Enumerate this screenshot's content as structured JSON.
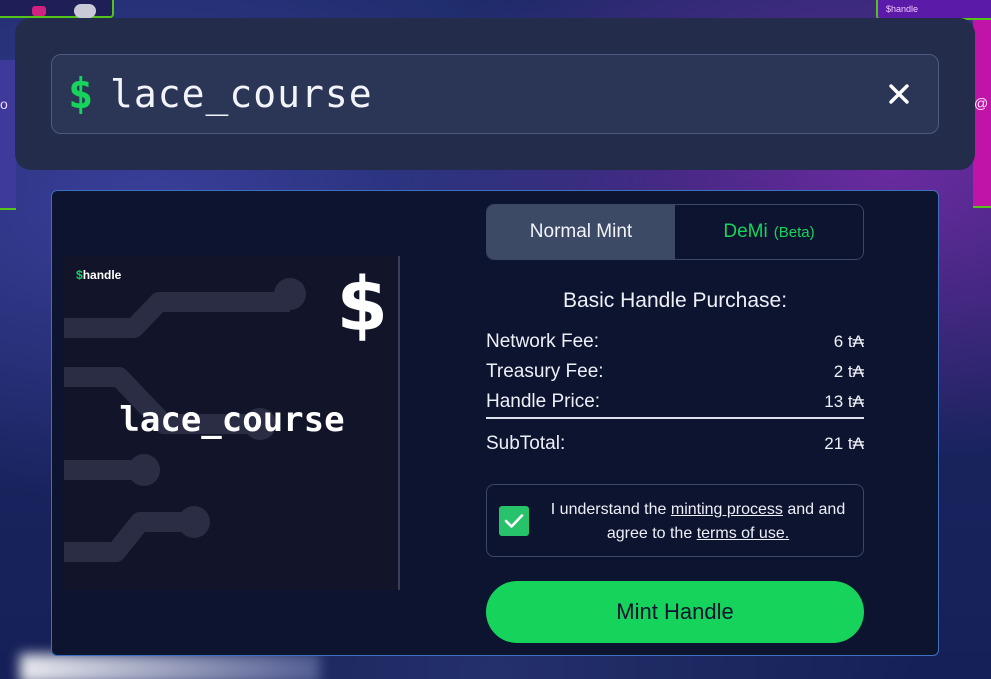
{
  "background": {
    "right_card_label": "$handle",
    "left_edge_glyph": "o",
    "right_edge_glyph": "@"
  },
  "search": {
    "prefix_icon": "dollar-icon",
    "value": "lace_course",
    "clear_icon": "close-icon"
  },
  "card": {
    "brand_prefix": "$",
    "brand_name": "handle",
    "symbol": "$",
    "handle": "lace_course"
  },
  "tabs": [
    {
      "label": "Normal Mint",
      "active": true
    },
    {
      "label": "DeMi",
      "suffix": "(Beta)",
      "active": false
    }
  ],
  "purchase": {
    "title": "Basic Handle Purchase:",
    "fees": [
      {
        "label": "Network Fee:",
        "value": "6 t₳"
      },
      {
        "label": "Treasury Fee:",
        "value": "2 t₳"
      },
      {
        "label": "Handle Price:",
        "value": "13 t₳"
      }
    ],
    "subtotal": {
      "label": "SubTotal:",
      "value": "21 t₳"
    }
  },
  "agreement": {
    "checked": true,
    "text_1": "I understand the",
    "link_1": "minting process",
    "text_2": "and and agree to the",
    "link_2": "terms of use."
  },
  "mint_button": {
    "label": "Mint Handle"
  },
  "colors": {
    "accent": "#15d35b",
    "panel": "#232c4a",
    "mint_panel": "#0d1430",
    "border": "#3f6fc1"
  }
}
